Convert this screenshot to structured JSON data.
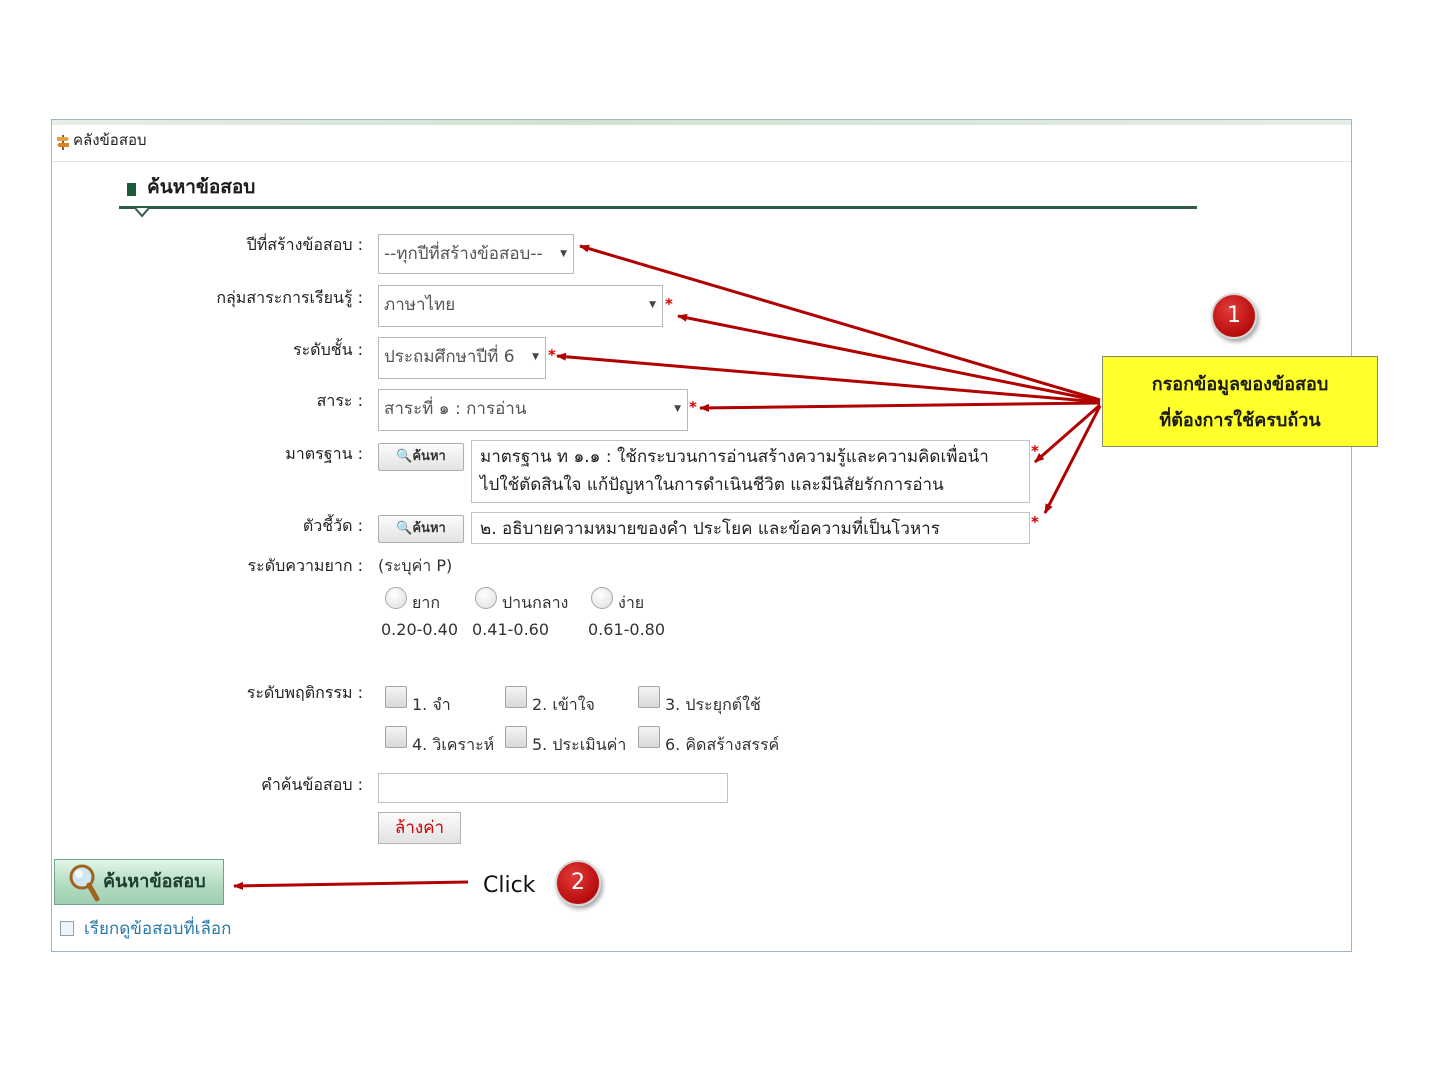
{
  "breadcrumb": {
    "label": "คลังข้อสอบ"
  },
  "section": {
    "title": "ค้นหาข้อสอบ"
  },
  "form": {
    "year": {
      "label": "ปีที่สร้างข้อสอบ :",
      "value": "--ทุกปีที่สร้างข้อสอบ--"
    },
    "subject_group": {
      "label": "กลุ่มสาระการเรียนรู้ :",
      "value": "ภาษาไทย"
    },
    "grade": {
      "label": "ระดับชั้น :",
      "value": "ประถมศึกษาปีที่ 6"
    },
    "strand": {
      "label": "สาระ :",
      "value": "สาระที่ ๑ : การอ่าน"
    },
    "standard": {
      "label": "มาตรฐาน :",
      "button": "ค้นหา",
      "value_line1": "มาตรฐาน ท ๑.๑ : ใช้กระบวนการอ่านสร้างความรู้และความคิดเพื่อนำ",
      "value_line2": "ไปใช้ตัดสินใจ แก้ปัญหาในการดำเนินชีวิต และมีนิสัยรักการอ่าน"
    },
    "indicator": {
      "label": "ตัวชี้วัด :",
      "button": "ค้นหา",
      "value": "๒. อธิบายความหมายของคำ ประโยค และข้อความที่เป็นโวหาร"
    },
    "required_mark": "*",
    "difficulty": {
      "label": "ระดับความยาก :",
      "hint": "(ระบุค่า P)",
      "options": [
        {
          "label": "ยาก",
          "range": "0.20-0.40"
        },
        {
          "label": "ปานกลาง",
          "range": "0.41-0.60"
        },
        {
          "label": "ง่าย",
          "range": "0.61-0.80"
        }
      ]
    },
    "behavior": {
      "label": "ระดับพฤติกรรม :",
      "options": [
        "1. จำ",
        "2. เข้าใจ",
        "3. ประยุกต์ใช้",
        "4. วิเคราะห์",
        "5. ประเมินค่า",
        "6. คิดสร้างสรรค์"
      ]
    },
    "keyword": {
      "label": "คำค้นข้อสอบ :",
      "value": ""
    },
    "clear_button": "ล้างค่า"
  },
  "search_button": "ค้นหาข้อสอบ",
  "selected_link": "เรียกดูข้อสอบที่เลือก",
  "annotation": {
    "callout_line1": "กรอกข้อมูลของข้อสอบ",
    "callout_line2": "ที่ต้องการใช้ครบถ้วน",
    "badge1": "1",
    "badge2": "2",
    "click_label": "Click"
  },
  "colors": {
    "section_accent": "#2f5e46",
    "required": "#dd0000",
    "annotation_arrow": "#b00000",
    "callout_bg": "#ffff2a",
    "badge": "#c40f0f",
    "link": "#2a78a8"
  }
}
